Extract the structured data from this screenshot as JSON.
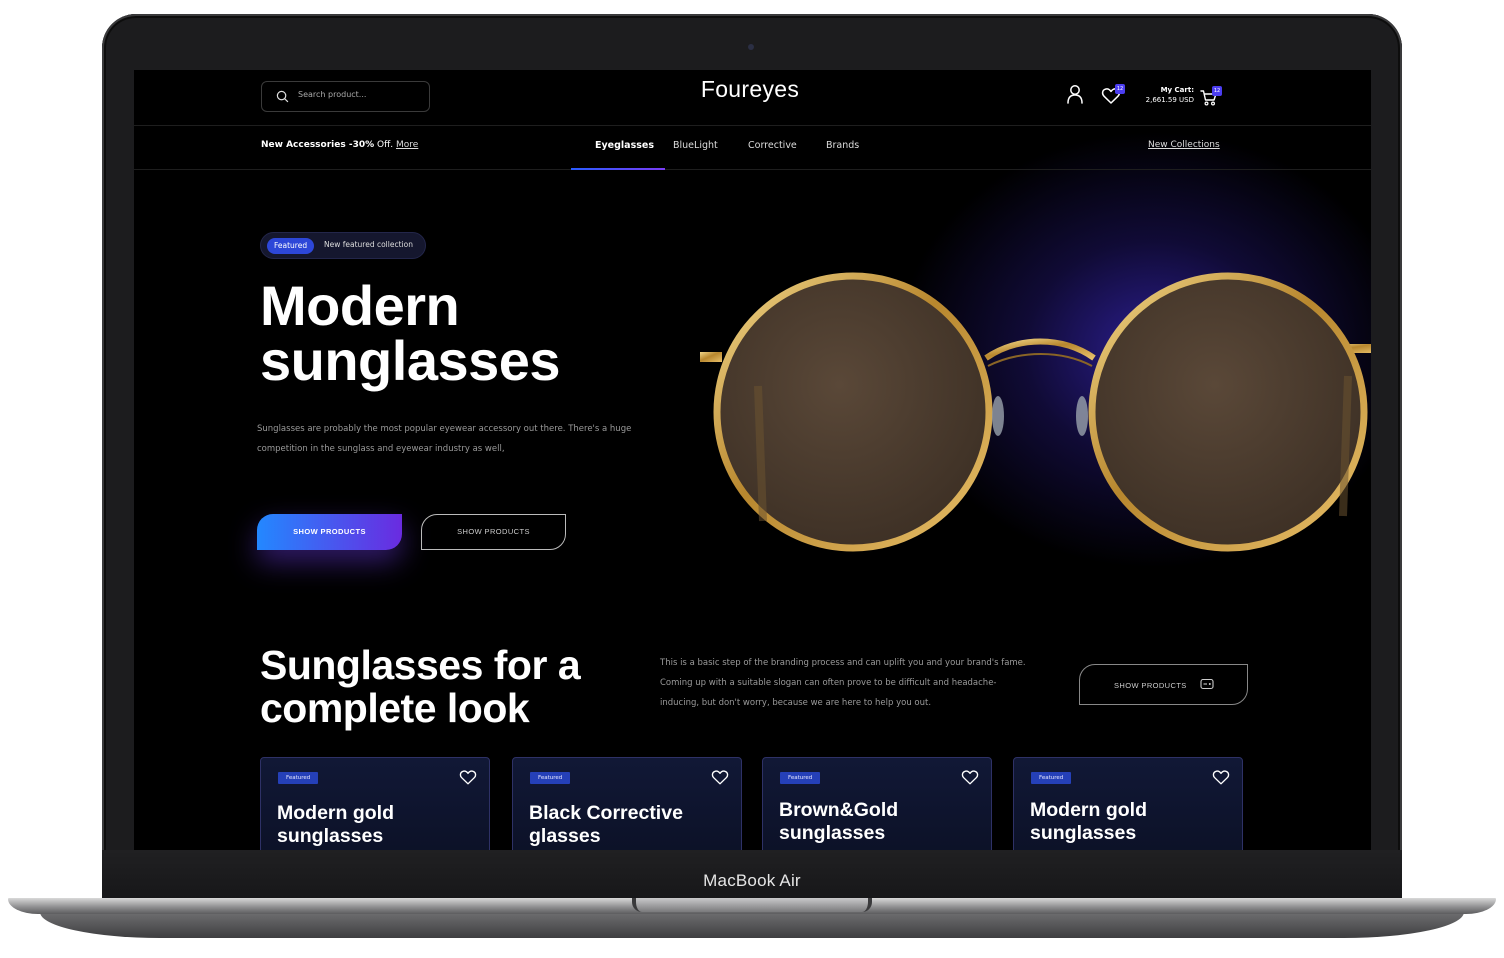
{
  "device": {
    "label": "MacBook Air"
  },
  "header": {
    "search_placeholder": "Search product...",
    "logo": "Foureyes",
    "wishlist_count": "12",
    "cart": {
      "label": "My Cart:",
      "total": "2,661.59 USD",
      "count": "12"
    }
  },
  "subnav": {
    "promo_bold": "New Accessories -30%",
    "promo_rest": " Off. ",
    "promo_link": "More",
    "items": [
      {
        "label": "Eyeglasses"
      },
      {
        "label": "BlueLight"
      },
      {
        "label": "Corrective"
      },
      {
        "label": "Brands"
      }
    ],
    "active_index": 0,
    "right_link": "New Collections"
  },
  "hero": {
    "pill_tag": "Featured",
    "pill_text": "New featured collection",
    "title_line1": "Modern",
    "title_line2": "sunglasses",
    "description": "Sunglasses are probably the most popular eyewear accessory out there. There's a huge competition in the sunglass and eyewear industry as well,",
    "primary_button": "SHOW PRODUCTS",
    "secondary_button": "SHOW PRODUCTS"
  },
  "section": {
    "title_line1": "Sunglasses for a",
    "title_line2": "complete look",
    "description": "This is a basic step of the branding process and can uplift you and your brand's fame. Coming up with a suitable slogan can often prove to be difficult and headache-inducing, but don't worry, because we are here to help you out.",
    "button": "SHOW PRODUCTS"
  },
  "cards": [
    {
      "tag": "Featured",
      "title": "Modern gold sunglasses"
    },
    {
      "tag": "Featured",
      "title": "Black Corrective glasses"
    },
    {
      "tag": "Featured",
      "title": "Brown&Gold sunglasses"
    },
    {
      "tag": "Featured",
      "title": "Modern gold sunglasses"
    }
  ],
  "colors": {
    "accent_blue": "#2388ff",
    "accent_purple": "#6a2be0",
    "badge": "#4b3df0",
    "glow": "#3a28be",
    "gold": "#c9a24a"
  }
}
